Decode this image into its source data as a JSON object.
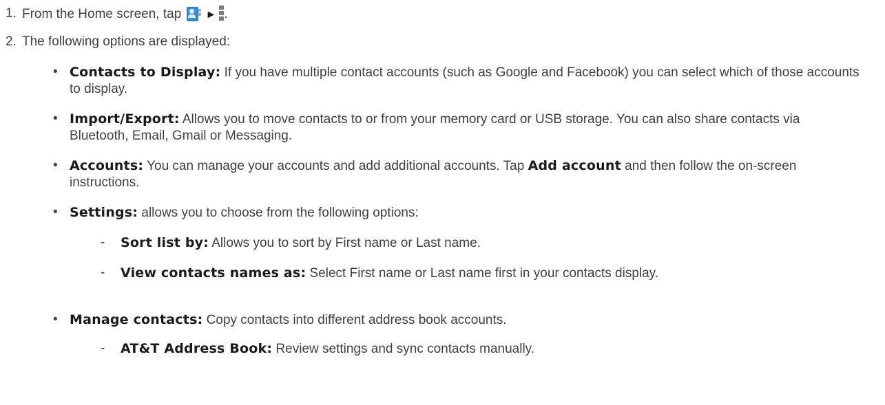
{
  "steps": [
    {
      "num": "1.",
      "before_icons": "From the Home screen, tap",
      "after_icons": "."
    },
    {
      "num": "2.",
      "text": "The following options are displayed:"
    }
  ],
  "icons": {
    "contacts": "contacts-app-icon",
    "arrow": "►",
    "menu": "menu-icon"
  },
  "options": [
    {
      "bullet": "•",
      "label": "Contacts to Display:",
      "text": " If you have multiple contact accounts (such as Google and Facebook) you can select which of those accounts to display."
    },
    {
      "bullet": "•",
      "label": "Import/Export:",
      "text": " Allows you to move contacts to or from your memory card or USB storage. You can also share contacts via Bluetooth, Email, Gmail or Messaging."
    },
    {
      "bullet": "•",
      "label": "Accounts:",
      "text_before": " You can manage your accounts and add additional accounts. Tap ",
      "inline_bold": "Add account",
      "text_after": " and then follow the on-screen instructions."
    },
    {
      "bullet": "•",
      "label": "Settings:",
      "text": " allows you to choose from the following options:",
      "sub": [
        {
          "dash": "-",
          "label": "Sort list by:",
          "text": " Allows you to sort by First name or Last name."
        },
        {
          "dash": "-",
          "label": "View contacts names as:",
          "text": " Select First name or Last name first in your contacts display."
        }
      ]
    },
    {
      "bullet": "•",
      "label": "Manage contacts:",
      "text": " Copy contacts into different address book accounts.",
      "sub": [
        {
          "dash": "-",
          "label": "AT&T Address Book:",
          "text": " Review settings and sync contacts manually."
        }
      ]
    }
  ]
}
